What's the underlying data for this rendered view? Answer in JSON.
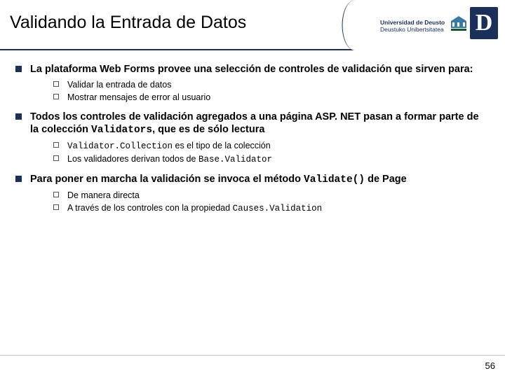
{
  "header": {
    "title": "Validando la Entrada de Datos",
    "logo": {
      "letter": "D",
      "line1": "Universidad de Deusto",
      "line2": "Deustuko Unibertsitatea"
    }
  },
  "content": {
    "items": [
      {
        "text": "La plataforma Web Forms provee una selección de controles de validación que sirven para:",
        "subs": [
          {
            "text": "Validar la entrada de datos"
          },
          {
            "text": "Mostrar mensajes de error al usuario"
          }
        ]
      },
      {
        "html": "Todos los controles de validación agregados a una página ASP. NET pasan a formar parte de la colección <span class=\"mono\">Validators</span>, que es de sólo lectura",
        "subs": [
          {
            "html": "<span class=\"mono\">Validator.Collection</span> es el tipo de la colección"
          },
          {
            "html": "Los validadores derivan todos de <span class=\"mono\">Base.Validator</span>"
          }
        ]
      },
      {
        "html": "Para poner en marcha la validación se invoca el método <span class=\"mono\">Validate()</span> de Page",
        "subs": [
          {
            "text": "De manera directa"
          },
          {
            "html": "A través de los controles con la propiedad <span class=\"mono\">Causes.Validation</span>"
          }
        ]
      }
    ]
  },
  "page_number": "56"
}
